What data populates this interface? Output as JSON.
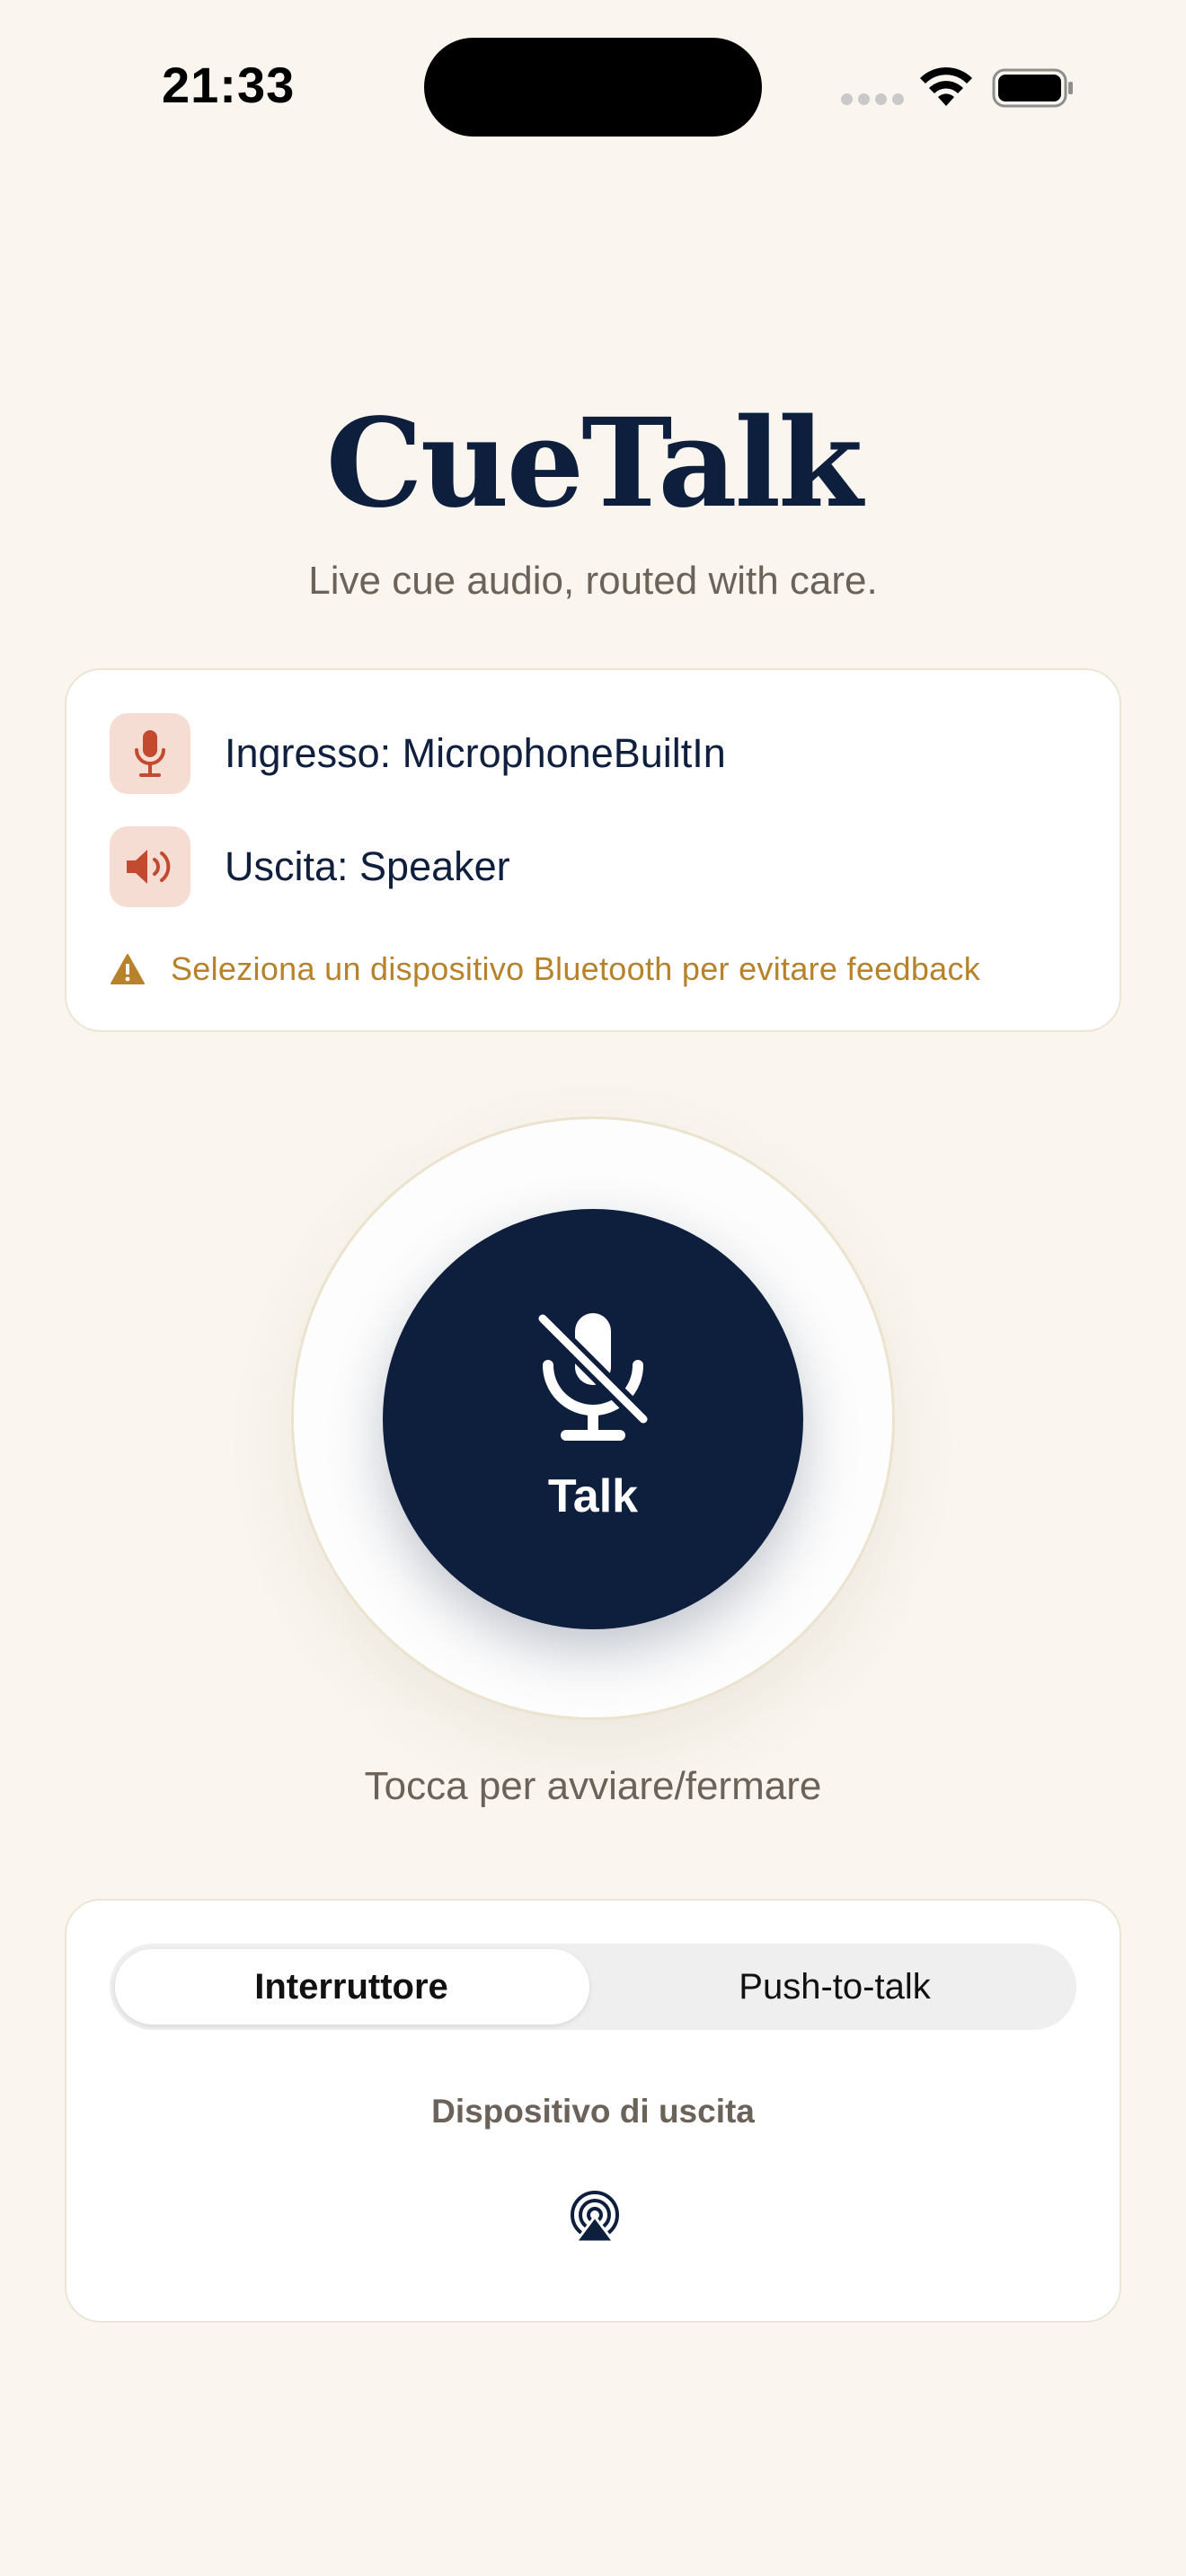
{
  "status_bar": {
    "time": "21:33"
  },
  "header": {
    "title": "CueTalk",
    "subtitle": "Live cue audio, routed with care."
  },
  "devices": {
    "input_label": "Ingresso: MicrophoneBuiltIn",
    "output_label": "Uscita: Speaker",
    "warning": "Seleziona un dispositivo Bluetooth per evitare feedback",
    "icon_bg": "#f6ddd3",
    "icon_color": "#c24a2f",
    "warning_color": "#b7822a"
  },
  "talk": {
    "label": "Talk",
    "hint": "Tocca per avviare/fermare",
    "button_color": "#0e1f3e"
  },
  "mode": {
    "options": [
      "Interruttore",
      "Push-to-talk"
    ],
    "selected": "Interruttore",
    "output_heading": "Dispositivo di uscita"
  },
  "icons": [
    "mic-icon",
    "speaker-icon",
    "warning-icon",
    "mic-off-icon",
    "airplay-icon",
    "wifi-icon",
    "battery-icon"
  ]
}
